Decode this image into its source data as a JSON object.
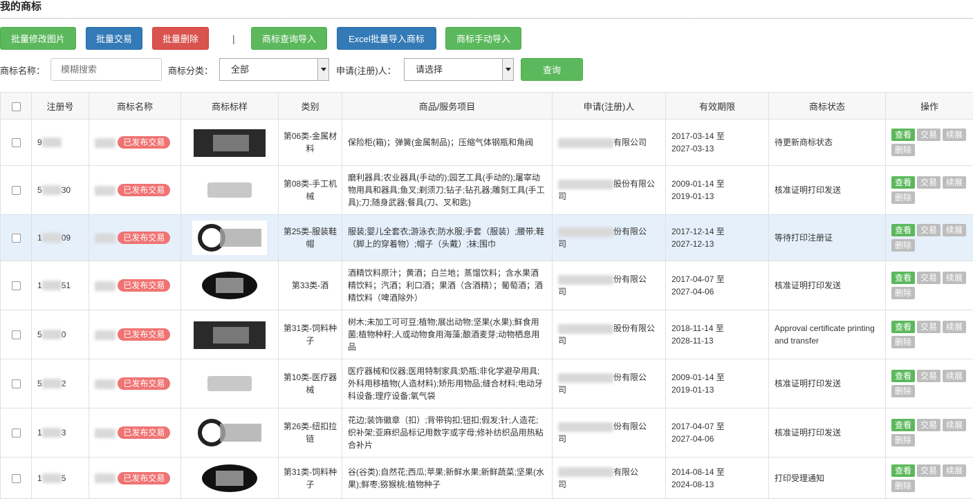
{
  "page": {
    "title": "我的商标"
  },
  "toolbar": {
    "batch_edit_image": "批量修改图片",
    "batch_trade": "批量交易",
    "batch_delete": "批量删除",
    "separator": "|",
    "query_import": "商标查询导入",
    "excel_import": "Excel批量导入商标",
    "manual_import": "商标手动导入"
  },
  "search": {
    "name_label": "商标名称：",
    "name_placeholder": "模糊搜索",
    "category_label": "商标分类：",
    "category_value": "全部",
    "applicant_label": "申请(注册)人：",
    "applicant_value": "请选择",
    "query_button": "查询"
  },
  "table": {
    "headers": [
      "注册号",
      "商标名称",
      "商标标样",
      "类别",
      "商品/服务项目",
      "申请(注册)人",
      "有效期限",
      "商标状态",
      "操作"
    ],
    "badge_text": "已发布交易",
    "actions": [
      "查看",
      "交易",
      "续展",
      "删除"
    ],
    "rows": [
      {
        "regno_a": "9",
        "regno_b": "",
        "category": "第06类-金属材料",
        "goods": "保险柜(箱)；弹簧(金属制品)；压缩气体钢瓶和角阀",
        "applicant": "有限公司",
        "applicant_2": "",
        "date_from": "2017-03-14 至",
        "date_to": "2027-03-13",
        "status": "待更新商标状态",
        "highlight": false
      },
      {
        "regno_a": "5",
        "regno_b": "30",
        "category": "第08类-手工机械",
        "goods": "磨利器具;农业器具(手动的);园艺工具(手动的);屠宰动物用具和器具;鱼叉;剃须刀;钻子;钻孔器;雕刻工具(手工具);刀;随身武器;餐具(刀、叉和匙)",
        "applicant": "股份有限公",
        "applicant_2": "司",
        "date_from": "2009-01-14 至",
        "date_to": "2019-01-13",
        "status": "核准证明打印发送",
        "highlight": false
      },
      {
        "regno_a": "1",
        "regno_b": "09",
        "category": "第25类-服装鞋帽",
        "goods": "服装;婴儿全套衣;游泳衣;防水服;手套（服装）;腰带;鞋（脚上的穿着物）;帽子（头戴）;袜;围巾",
        "applicant": "份有限公",
        "applicant_2": "司",
        "date_from": "2017-12-14 至",
        "date_to": "2027-12-13",
        "status": "等待打印注册证",
        "highlight": true
      },
      {
        "regno_a": "1",
        "regno_b": "51",
        "category": "第33类-酒",
        "goods": "酒精饮料原汁；黄酒；白兰地；蒸馏饮料；含水果酒精饮料；汽酒；利口酒；果酒（含酒精）；葡萄酒；酒精饮料（啤酒除外）",
        "applicant": "份有限公",
        "applicant_2": "司",
        "date_from": "2017-04-07 至",
        "date_to": "2027-04-06",
        "status": "核准证明打印发送",
        "highlight": false
      },
      {
        "regno_a": "5",
        "regno_b": "0",
        "category": "第31类-饲料种子",
        "goods": "树木;未加工可可豆;植物;展出动物;坚果(水果);鲜食用菌;植物种籽;人或动物食用海藻;酿酒麦芽;动物栖息用品",
        "applicant": "股份有限公",
        "applicant_2": "司",
        "date_from": "2018-11-14 至",
        "date_to": "2028-11-13",
        "status": "Approval certificate printing and transfer",
        "highlight": false
      },
      {
        "regno_a": "5",
        "regno_b": "2",
        "category": "第10类-医疗器械",
        "goods": "医疗器械和仪器;医用特制家具;奶瓶;非化学避孕用具;外科用移植物(人造材料);矫形用物品;缝合材料;电动牙科设备;理疗设备;氧气袋",
        "applicant": "份有限公",
        "applicant_2": "司",
        "date_from": "2009-01-14 至",
        "date_to": "2019-01-13",
        "status": "核准证明打印发送",
        "highlight": false
      },
      {
        "regno_a": "1",
        "regno_b": "3",
        "category": "第26类-纽扣拉链",
        "goods": "花边;装饰徽章（扣）;背带钩扣;钮扣;假发;针;人造花;织补架;亚麻织品标记用数字或字母;修补纺织品用热粘合补片",
        "applicant": "份有限公",
        "applicant_2": "司",
        "date_from": "2017-04-07 至",
        "date_to": "2027-04-06",
        "status": "核准证明打印发送",
        "highlight": false
      },
      {
        "regno_a": "1",
        "regno_b": "5",
        "category": "第31类-饲料种子",
        "goods": "谷(谷类);自然花;西瓜;苹果;新鲜水果;新鲜蔬菜;坚果(水果);鲜枣;猕猴桃;植物种子",
        "applicant": "有限公",
        "applicant_2": "司",
        "date_from": "2014-08-14 至",
        "date_to": "2024-08-13",
        "status": "打印受理通知",
        "highlight": false
      }
    ]
  }
}
